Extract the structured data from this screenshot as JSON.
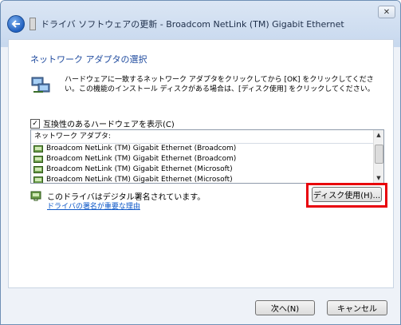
{
  "window": {
    "title": "ドライバ ソフトウェアの更新 - Broadcom NetLink (TM) Gigabit Ethernet",
    "close_glyph": "✕"
  },
  "main": {
    "heading": "ネットワーク アダプタの選択",
    "description": "ハードウェアに一致するネットワーク アダプタをクリックしてから [OK] をクリックしてください。この機能のインストール ディスクがある場合は、[ディスク使用] をクリックしてください。",
    "compatible_checkbox": {
      "label": "互換性のあるハードウェアを表示(C)",
      "checked": true,
      "check_glyph": "✓"
    },
    "list": {
      "header": "ネットワーク アダプタ:",
      "items": [
        "Broadcom NetLink (TM) Gigabit Ethernet (Broadcom)",
        "Broadcom NetLink (TM) Gigabit Ethernet (Broadcom)",
        "Broadcom NetLink (TM) Gigabit Ethernet (Microsoft)",
        "Broadcom NetLink (TM) Gigabit Ethernet (Microsoft)"
      ],
      "scroll_up_glyph": "▲",
      "scroll_down_glyph": "▼"
    },
    "signed_text": "このドライバはデジタル署名されています。",
    "why_link": "ドライバの署名が重要な理由",
    "disk_button": "ディスク使用(H)...",
    "highlight_color": "#e8000b"
  },
  "footer": {
    "next_button": "次へ(N)",
    "cancel_button": "キャンセル"
  },
  "icons": [
    "back-arrow-icon",
    "driver-icon",
    "network-adapter-icon",
    "adapter-item-icon",
    "certificate-icon"
  ]
}
